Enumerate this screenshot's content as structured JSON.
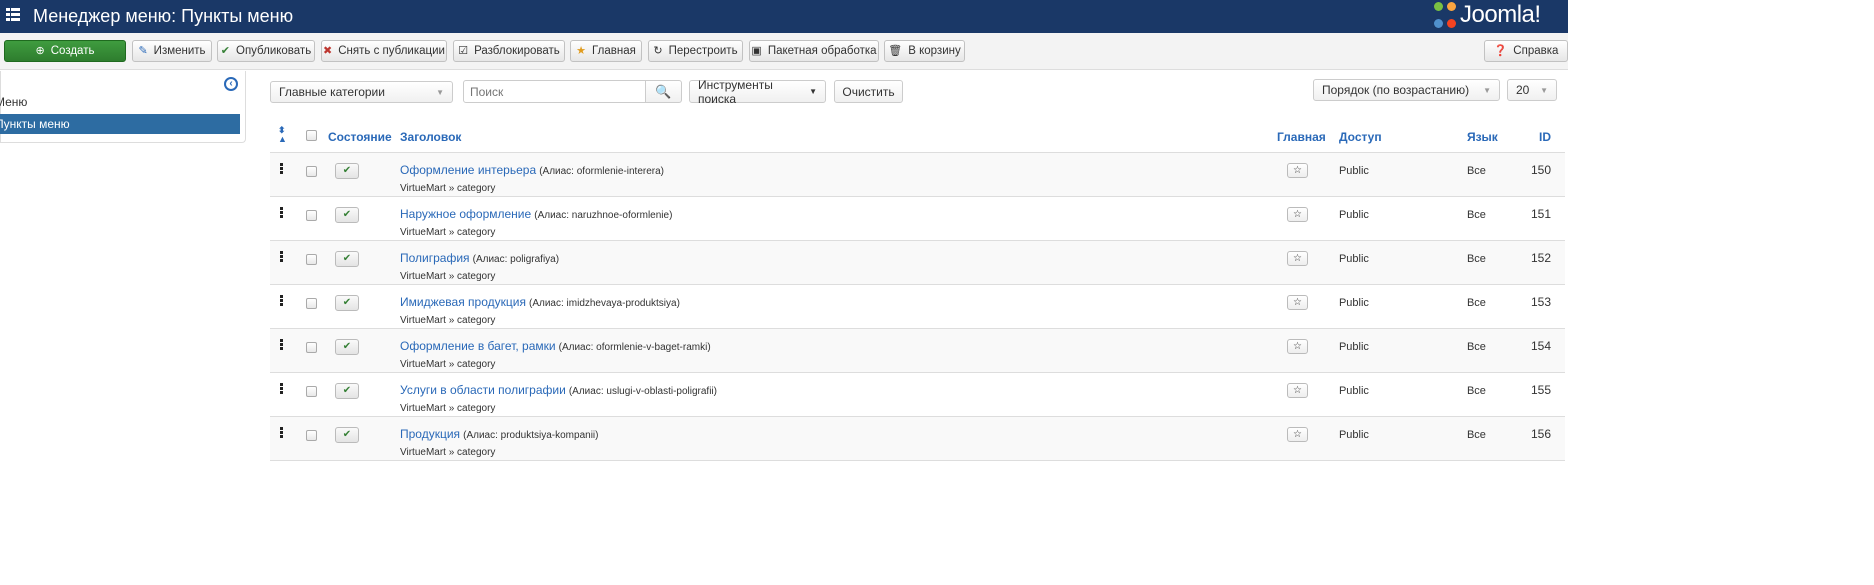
{
  "header": {
    "title": "Менеджер меню: Пункты меню",
    "logo": "Joomla!"
  },
  "toolbar": {
    "new": "Создать",
    "edit": "Изменить",
    "publish": "Опубликовать",
    "unpublish": "Снять с публикации",
    "checkin": "Разблокировать",
    "home": "Главная",
    "rebuild": "Перестроить",
    "batch": "Пакетная обработка",
    "trash": "В корзину",
    "help": "Справка"
  },
  "sidebar": {
    "items": [
      {
        "label": "Меню"
      },
      {
        "label": "Пункты меню"
      }
    ]
  },
  "filters": {
    "menu_select": "Главные категории",
    "search_placeholder": "Поиск",
    "search_tools": "Инструменты поиска",
    "clear": "Очистить",
    "ordering": "Порядок (по возрастанию)",
    "limit": "20"
  },
  "table": {
    "headers": {
      "state": "Состояние",
      "title": "Заголовок",
      "home": "Главная",
      "access": "Доступ",
      "language": "Язык",
      "id": "ID"
    },
    "rows": [
      {
        "title": "Оформление интерьера",
        "alias": "(Алиас: oformlenie-interera)",
        "type": "VirtueMart » category",
        "access": "Public",
        "language": "Все",
        "id": "150"
      },
      {
        "title": "Наружное оформление",
        "alias": "(Алиас: naruzhnoe-oformlenie)",
        "type": "VirtueMart » category",
        "access": "Public",
        "language": "Все",
        "id": "151"
      },
      {
        "title": "Полиграфия",
        "alias": "(Алиас: poligrafiya)",
        "type": "VirtueMart » category",
        "access": "Public",
        "language": "Все",
        "id": "152"
      },
      {
        "title": "Имиджевая продукция",
        "alias": "(Алиас: imidzhevaya-produktsiya)",
        "type": "VirtueMart » category",
        "access": "Public",
        "language": "Все",
        "id": "153"
      },
      {
        "title": "Оформление в багет, рамки",
        "alias": "(Алиас: oformlenie-v-baget-ramki)",
        "type": "VirtueMart » category",
        "access": "Public",
        "language": "Все",
        "id": "154"
      },
      {
        "title": "Услуги в области полиграфии",
        "alias": "(Алиас: uslugi-v-oblasti-poligrafii)",
        "type": "VirtueMart » category",
        "access": "Public",
        "language": "Все",
        "id": "155"
      },
      {
        "title": "Продукция",
        "alias": "(Алиас: produktsiya-kompanii)",
        "type": "VirtueMart » category",
        "access": "Public",
        "language": "Все",
        "id": "156"
      }
    ]
  }
}
